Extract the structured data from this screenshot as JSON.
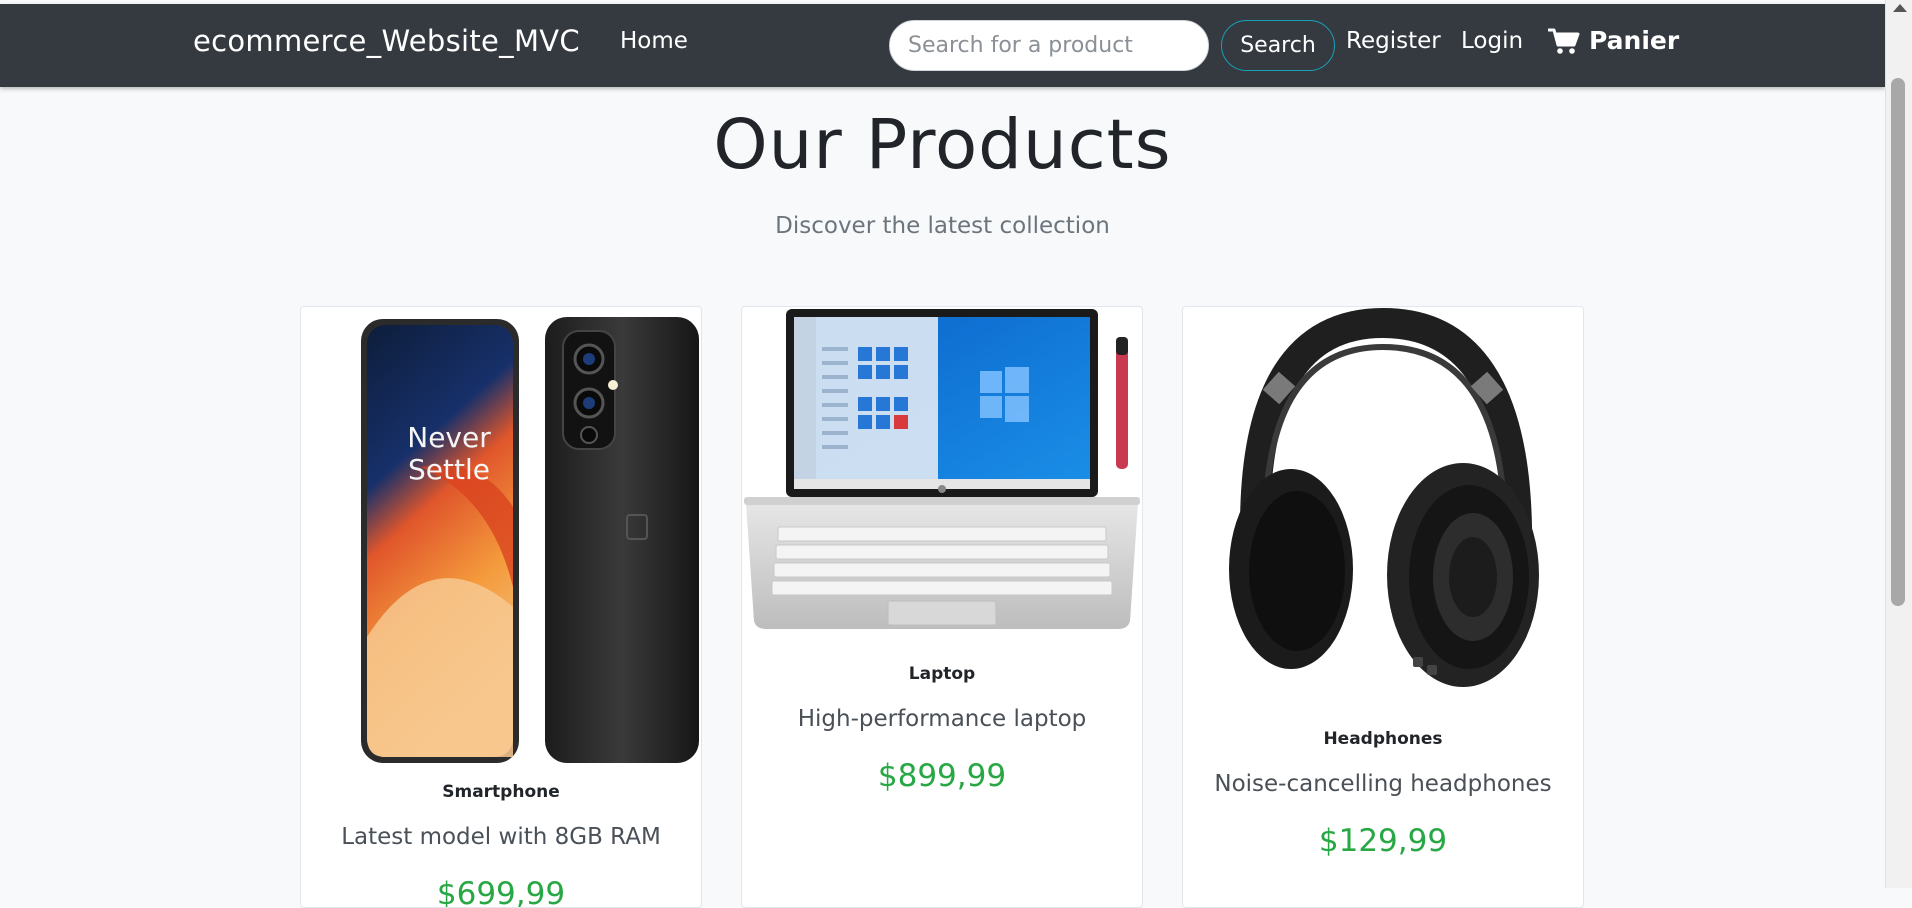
{
  "navbar": {
    "brand": "ecommerce_Website_MVC",
    "home_label": "Home",
    "search_placeholder": "Search for a product",
    "search_button": "Search",
    "register_label": "Register",
    "login_label": "Login",
    "cart_label": "Panier",
    "cart_icon": "shopping-cart-icon"
  },
  "main": {
    "title": "Our Products",
    "subtitle": "Discover the latest collection"
  },
  "products": [
    {
      "name": "Smartphone",
      "description": "Latest model with 8GB RAM",
      "price": "$699,99",
      "image": "smartphone-image"
    },
    {
      "name": "Laptop",
      "description": "High-performance laptop",
      "price": "$899,99",
      "image": "laptop-image"
    },
    {
      "name": "Headphones",
      "description": "Noise-cancelling headphones",
      "price": "$129,99",
      "image": "headphones-image"
    }
  ],
  "colors": {
    "navbar": "#343a40",
    "background": "#f8f9fa",
    "price": "#28a745",
    "search_outline": "#17a2b8"
  }
}
